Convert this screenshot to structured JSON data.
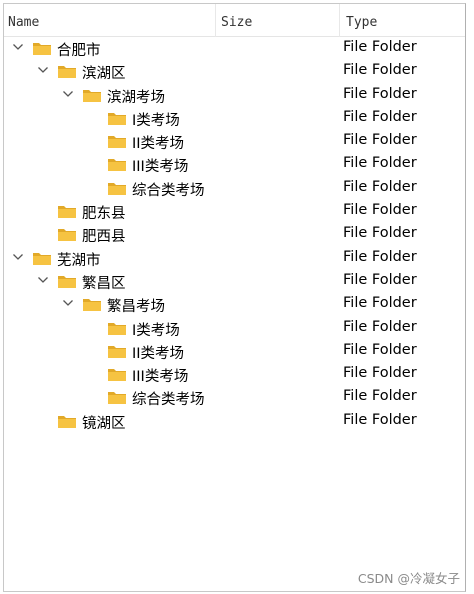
{
  "columns": {
    "name": "Name",
    "size": "Size",
    "type": "Type"
  },
  "rows": [
    {
      "label": "合肥市",
      "type": "File Folder",
      "level": 0,
      "expanded": true
    },
    {
      "label": "滨湖区",
      "type": "File Folder",
      "level": 1,
      "expanded": true
    },
    {
      "label": "滨湖考场",
      "type": "File Folder",
      "level": 2,
      "expanded": true
    },
    {
      "label": "I类考场",
      "type": "File Folder",
      "level": 3,
      "expanded": false
    },
    {
      "label": "II类考场",
      "type": "File Folder",
      "level": 3,
      "expanded": false
    },
    {
      "label": "III类考场",
      "type": "File Folder",
      "level": 3,
      "expanded": false
    },
    {
      "label": "综合类考场",
      "type": "File Folder",
      "level": 3,
      "expanded": false
    },
    {
      "label": "肥东县",
      "type": "File Folder",
      "level": 1,
      "expanded": false
    },
    {
      "label": "肥西县",
      "type": "File Folder",
      "level": 1,
      "expanded": false
    },
    {
      "label": "芜湖市",
      "type": "File Folder",
      "level": 0,
      "expanded": true
    },
    {
      "label": "繁昌区",
      "type": "File Folder",
      "level": 1,
      "expanded": true
    },
    {
      "label": "繁昌考场",
      "type": "File Folder",
      "level": 2,
      "expanded": true
    },
    {
      "label": "I类考场",
      "type": "File Folder",
      "level": 3,
      "expanded": false
    },
    {
      "label": "II类考场",
      "type": "File Folder",
      "level": 3,
      "expanded": false
    },
    {
      "label": "III类考场",
      "type": "File Folder",
      "level": 3,
      "expanded": false
    },
    {
      "label": "综合类考场",
      "type": "File Folder",
      "level": 3,
      "expanded": false
    },
    {
      "label": "镜湖区",
      "type": "File Folder",
      "level": 1,
      "expanded": false
    }
  ],
  "watermark": "CSDN @冷凝女子",
  "colors": {
    "folder": "#f6c342",
    "folder_dark": "#e2a928",
    "chevron": "#555555"
  }
}
